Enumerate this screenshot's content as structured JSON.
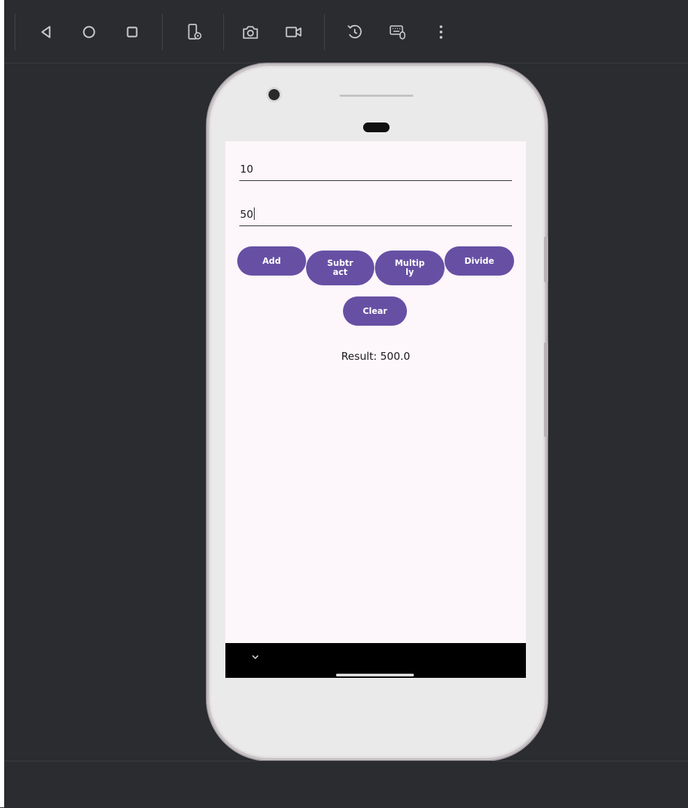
{
  "toolbar": {
    "buttons": [
      {
        "name": "back-icon"
      },
      {
        "name": "home-icon"
      },
      {
        "name": "overview-icon"
      },
      {
        "name": "device-settings-icon"
      },
      {
        "name": "screenshot-icon"
      },
      {
        "name": "screen-record-icon"
      },
      {
        "name": "rotate-icon"
      },
      {
        "name": "keyboard-mouse-icon"
      },
      {
        "name": "more-options-icon"
      }
    ]
  },
  "app": {
    "first_number": "10",
    "second_number": "50",
    "buttons": {
      "add": "Add",
      "subtract": "Subtract",
      "multiply": "Multiply",
      "divide": "Divide",
      "clear": "Clear"
    },
    "result": "Result: 500.0"
  },
  "colors": {
    "button": "#6750a4",
    "screen_background": "#fdf6fb",
    "emulator_background": "#2b2c30"
  }
}
